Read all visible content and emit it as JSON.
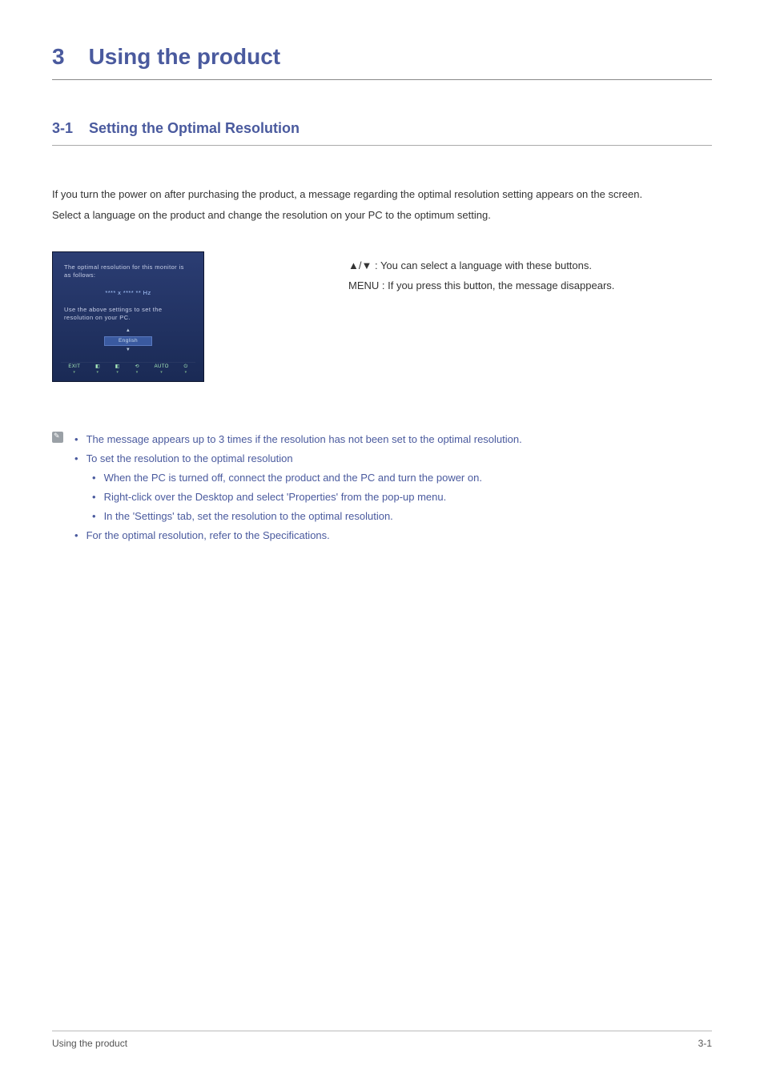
{
  "chapter": {
    "number": "3",
    "title": "Using the product"
  },
  "section": {
    "number": "3-1",
    "title": "Setting the Optimal Resolution"
  },
  "intro": {
    "line1": "If you turn the power on after purchasing the product, a message regarding the optimal resolution setting appears on the screen.",
    "line2": "Select a language on the product and change the resolution on your PC to the optimum setting."
  },
  "osd": {
    "line1": "The optimal resolution for this monitor is as follows:",
    "res": "**** x ****   ** Hz",
    "line3": "Use the above settings to set the resolution on your PC.",
    "tri_up": "▲",
    "lang": "English",
    "tri_down": "▼",
    "icons": {
      "exit": "EXIT",
      "i1": "◧",
      "i2": "◧",
      "i3": "⟲",
      "auto": "AUTO",
      "power": "⏻"
    }
  },
  "right": {
    "l1": "▲/▼ : You can select a language with these buttons.",
    "l2": "MENU : If you press this button, the message disappears."
  },
  "notes": {
    "a": "The message appears up to 3 times if the resolution has not been set to the optimal resolution.",
    "b": "To set the resolution to the optimal resolution",
    "b1": "When the PC is turned off, connect the product and the PC and turn the power on.",
    "b2": "Right-click over the Desktop and select 'Properties' from the pop-up menu.",
    "b3": "In the 'Settings' tab, set the resolution to the optimal resolution.",
    "c": "For the optimal resolution, refer to the Specifications."
  },
  "footer": {
    "left": "Using the product",
    "right": "3-1"
  }
}
